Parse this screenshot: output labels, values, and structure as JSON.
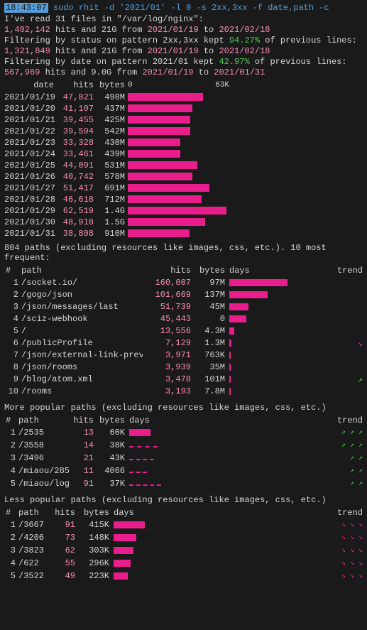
{
  "header": {
    "timestamp": "18:43:07",
    "command": "sudo rhit -d '2021/01' -l 0 -s 2xx,3xx -f date,path -c",
    "line2": "I've read 31 files in \"/var/log/nginx\":",
    "line3_prefix": "1,402,142",
    "line3_mid": " hits and 21G from ",
    "line3_from": "2021/01/19",
    "line3_to": "2021/02/18",
    "line4": "Filtering by status on pattern 2xx,3xx kept ",
    "line4_pct": "94.27%",
    "line4_suffix": " of previous lines:",
    "line5_prefix": "1,321,849",
    "line5_mid": " hits and 21G from ",
    "line5_from": "2021/01/19",
    "line5_to": "2021/02/18",
    "line6": "Filtering by date on pattern 2021/01 kept ",
    "line6_pct": "42.97%",
    "line6_suffix": " of previous lines:",
    "line7_prefix": "567,969",
    "line7_mid": " hits and 9.0G from ",
    "line7_from": "2021/01/19",
    "line7_to": "2021/01/31"
  },
  "chart": {
    "col_date": "date",
    "col_hits": "hits",
    "col_bytes": "bytes",
    "scale_min": "0",
    "scale_max": "63K",
    "rows": [
      {
        "date": "2021/01/19",
        "hits": "47,821",
        "bytes": "498M",
        "bar_pct": 76
      },
      {
        "date": "2021/01/20",
        "hits": "41,107",
        "bytes": "437M",
        "bar_pct": 65
      },
      {
        "date": "2021/01/21",
        "hits": "39,455",
        "bytes": "425M",
        "bar_pct": 63
      },
      {
        "date": "2021/01/22",
        "hits": "39,594",
        "bytes": "542M",
        "bar_pct": 63
      },
      {
        "date": "2021/01/23",
        "hits": "33,328",
        "bytes": "430M",
        "bar_pct": 53
      },
      {
        "date": "2021/01/24",
        "hits": "33,461",
        "bytes": "439M",
        "bar_pct": 53
      },
      {
        "date": "2021/01/25",
        "hits": "44,091",
        "bytes": "531M",
        "bar_pct": 70
      },
      {
        "date": "2021/01/26",
        "hits": "40,742",
        "bytes": "578M",
        "bar_pct": 65
      },
      {
        "date": "2021/01/27",
        "hits": "51,417",
        "bytes": "691M",
        "bar_pct": 82
      },
      {
        "date": "2021/01/28",
        "hits": "46,618",
        "bytes": "712M",
        "bar_pct": 74
      },
      {
        "date": "2021/01/29",
        "hits": "62,519",
        "bytes": "1.4G",
        "bar_pct": 99
      },
      {
        "date": "2021/01/30",
        "hits": "48,918",
        "bytes": "1.5G",
        "bar_pct": 78
      },
      {
        "date": "2021/01/31",
        "hits": "38,808",
        "bytes": "910M",
        "bar_pct": 62
      }
    ]
  },
  "paths_header": "804 paths (excluding resources like images, css, etc.). 10 most frequent:",
  "paths_cols": {
    "num": "#",
    "path": "path",
    "hits": "hits",
    "bytes": "bytes",
    "days": "days",
    "trend": "trend"
  },
  "paths": [
    {
      "num": "1",
      "path": "/socket.io/",
      "hits": "160,007",
      "bytes": "97M",
      "bar_pct": 100,
      "trend": ""
    },
    {
      "num": "2",
      "path": "/gogo/json",
      "hits": "101,669",
      "bytes": "137M",
      "bar_pct": 64,
      "trend": ""
    },
    {
      "num": "3",
      "path": "/json/messages/last",
      "hits": "51,739",
      "bytes": "45M",
      "bar_pct": 32,
      "trend": ""
    },
    {
      "num": "4",
      "path": "/sciz-webhook",
      "hits": "45,443",
      "bytes": "0",
      "bar_pct": 28,
      "trend": ""
    },
    {
      "num": "5",
      "path": "/",
      "hits": "13,556",
      "bytes": "4.3M",
      "bar_pct": 8,
      "trend": ""
    },
    {
      "num": "6",
      "path": "/publicProfile",
      "hits": "7,129",
      "bytes": "1.3M",
      "bar_pct": 4,
      "trend": "↘"
    },
    {
      "num": "7",
      "path": "/json/external-link-preview",
      "hits": "3,971",
      "bytes": "763K",
      "bar_pct": 2,
      "trend": ""
    },
    {
      "num": "8",
      "path": "/json/rooms",
      "hits": "3,939",
      "bytes": "35M",
      "bar_pct": 2,
      "trend": ""
    },
    {
      "num": "9",
      "path": "/blog/atom.xml",
      "hits": "3,478",
      "bytes": "101M",
      "bar_pct": 2,
      "trend": "↗"
    },
    {
      "num": "10",
      "path": "/rooms",
      "hits": "3,193",
      "bytes": "7.8M",
      "bar_pct": 2,
      "trend": ""
    }
  ],
  "more_popular_header": "More popular paths (excluding resources like images, css, etc.)",
  "more_cols": {
    "num": "#",
    "path": "path",
    "hits": "hits",
    "bytes": "bytes",
    "days": "days",
    "trend": "trend"
  },
  "more_paths": [
    {
      "num": "1",
      "path": "/2535",
      "hits": "13",
      "bytes": "60K",
      "bar_type": "solid",
      "bar_pct": 30,
      "trend": "↗ ↗ ↗"
    },
    {
      "num": "2",
      "path": "/3558",
      "hits": "14",
      "bytes": "38K",
      "bar_type": "dashed",
      "bar_pct": 40,
      "trend": "↗ ↗ ↗"
    },
    {
      "num": "3",
      "path": "/3496",
      "hits": "21",
      "bytes": "43K",
      "bar_type": "dashed",
      "bar_pct": 35,
      "trend": "↗ ↗"
    },
    {
      "num": "4",
      "path": "/miaou/285",
      "hits": "11",
      "bytes": "4066",
      "bar_type": "dashed",
      "bar_pct": 25,
      "trend": "↗ ↗"
    },
    {
      "num": "5",
      "path": "/miaou/login",
      "hits": "91",
      "bytes": "37K",
      "bar_type": "dashed",
      "bar_pct": 45,
      "trend": "↗ ↗"
    }
  ],
  "less_popular_header": "Less popular paths (excluding resources like images, css, etc.)",
  "less_cols": {
    "num": "#",
    "path": "path",
    "hits": "hits",
    "bytes": "bytes",
    "days": "days",
    "trend": "trend"
  },
  "less_paths": [
    {
      "num": "1",
      "path": "/3667",
      "hits": "91",
      "bytes": "415K",
      "bar_pct": 55,
      "trend": "↘ ↘ ↘"
    },
    {
      "num": "2",
      "path": "/4206",
      "hits": "73",
      "bytes": "148K",
      "bar_pct": 40,
      "trend": "↘ ↘ ↘"
    },
    {
      "num": "3",
      "path": "/3823",
      "hits": "62",
      "bytes": "303K",
      "bar_pct": 35,
      "trend": "↘ ↘ ↘"
    },
    {
      "num": "4",
      "path": "/622",
      "hits": "55",
      "bytes": "296K",
      "bar_pct": 30,
      "trend": "↘ ↘ ↘"
    },
    {
      "num": "5",
      "path": "/3522",
      "hits": "49",
      "bytes": "223K",
      "bar_pct": 25,
      "trend": "↘ ↘ ↘"
    }
  ]
}
